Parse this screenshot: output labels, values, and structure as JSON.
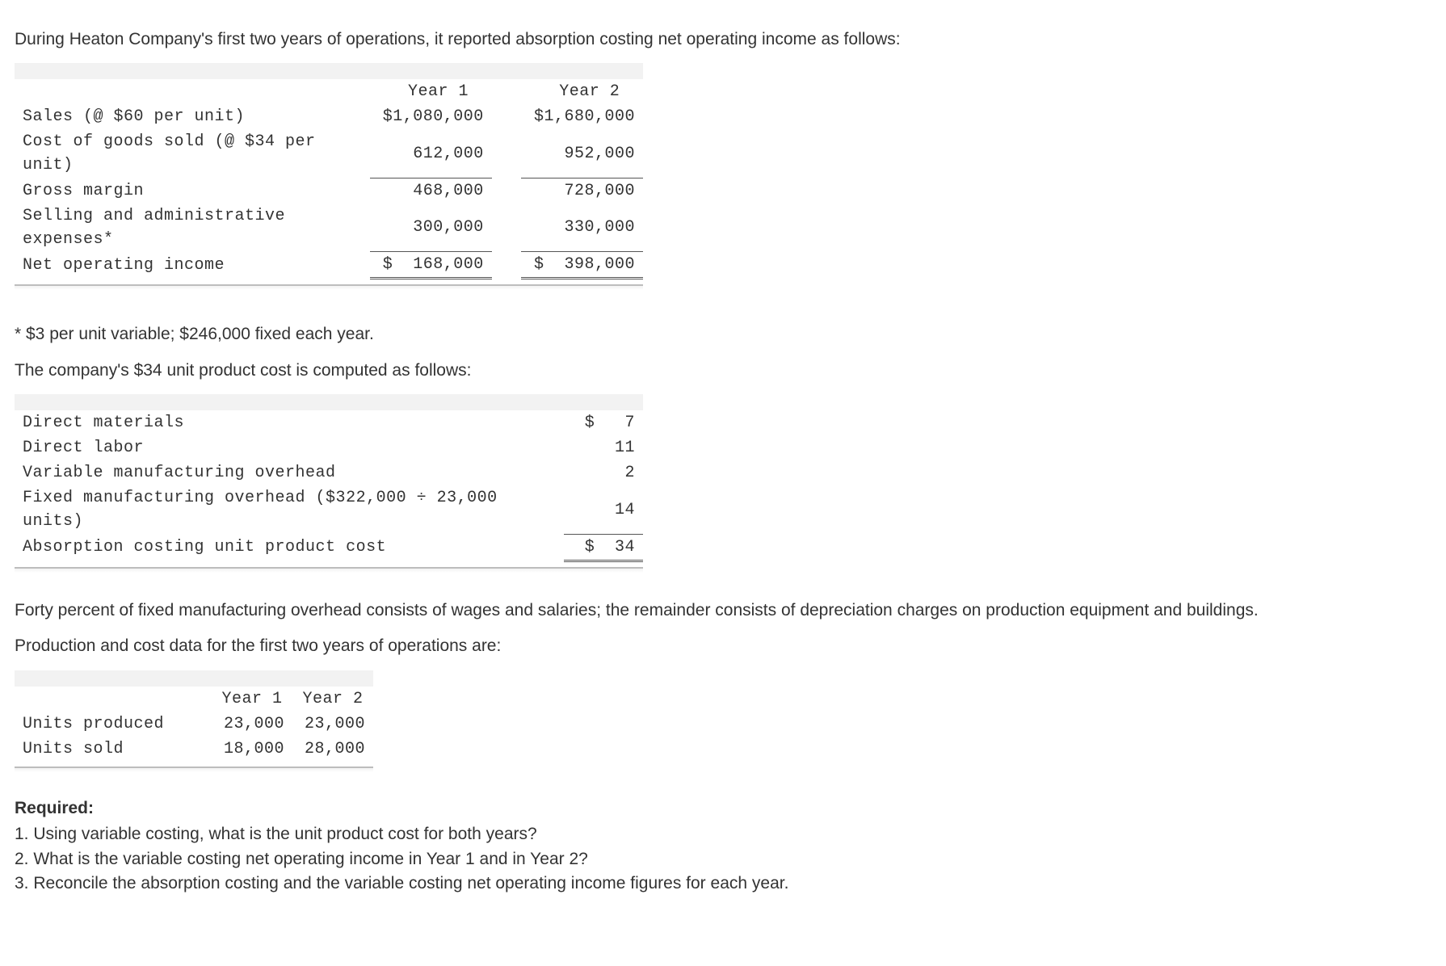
{
  "intro": "During Heaton Company's first two years of operations, it reported absorption costing net operating income as follows:",
  "table1": {
    "headers": {
      "y1": "Year 1",
      "y2": "Year 2"
    },
    "rows": {
      "sales": {
        "label": "Sales (@ $60 per unit)",
        "sym1": "$",
        "amt1": "1,080,000",
        "sym2": "$",
        "amt2": "1,680,000"
      },
      "cogs": {
        "label": "Cost of goods sold (@ $34 per unit)",
        "sym1": "",
        "amt1": "612,000",
        "sym2": "",
        "amt2": "952,000"
      },
      "gm": {
        "label": "Gross margin",
        "sym1": "",
        "amt1": "468,000",
        "sym2": "",
        "amt2": "728,000"
      },
      "sae": {
        "label": "Selling and administrative expenses*",
        "sym1": "",
        "amt1": "300,000",
        "sym2": "",
        "amt2": "330,000"
      },
      "noi": {
        "label": "Net operating income",
        "sym1": "$",
        "amt1": "168,000",
        "sym2": "$",
        "amt2": "398,000"
      }
    }
  },
  "footnote": "* $3 per unit variable; $246,000 fixed each year.",
  "para2": "The company's $34 unit product cost is computed as follows:",
  "table2": {
    "rows": {
      "dm": {
        "label": "Direct materials",
        "sym": "$",
        "amt": "7"
      },
      "dl": {
        "label": "Direct labor",
        "sym": "",
        "amt": "11"
      },
      "vmoh": {
        "label": "Variable manufacturing overhead",
        "sym": "",
        "amt": "2"
      },
      "fmoh": {
        "label": "Fixed manufacturing overhead ($322,000 ÷ 23,000 units)",
        "sym": "",
        "amt": "14"
      },
      "tot": {
        "label": "Absorption costing unit product cost",
        "sym": "$",
        "amt": "34"
      }
    }
  },
  "para3": "Forty percent of fixed manufacturing overhead consists of wages and salaries; the remainder consists of depreciation charges on production equipment and buildings.",
  "para4": "Production and cost data for the first two years of operations are:",
  "table3": {
    "headers": {
      "y1": "Year 1",
      "y2": "Year 2"
    },
    "rows": {
      "up": {
        "label": "Units produced",
        "y1": "23,000",
        "y2": "23,000"
      },
      "us": {
        "label": "Units sold",
        "y1": "18,000",
        "y2": "28,000"
      }
    }
  },
  "req_head": "Required:",
  "req1": "1. Using variable costing, what is the unit product cost for both years?",
  "req2": "2. What is the variable costing net operating income in Year 1 and in Year 2?",
  "req3": "3. Reconcile the absorption costing and the variable costing net operating income figures for each year."
}
